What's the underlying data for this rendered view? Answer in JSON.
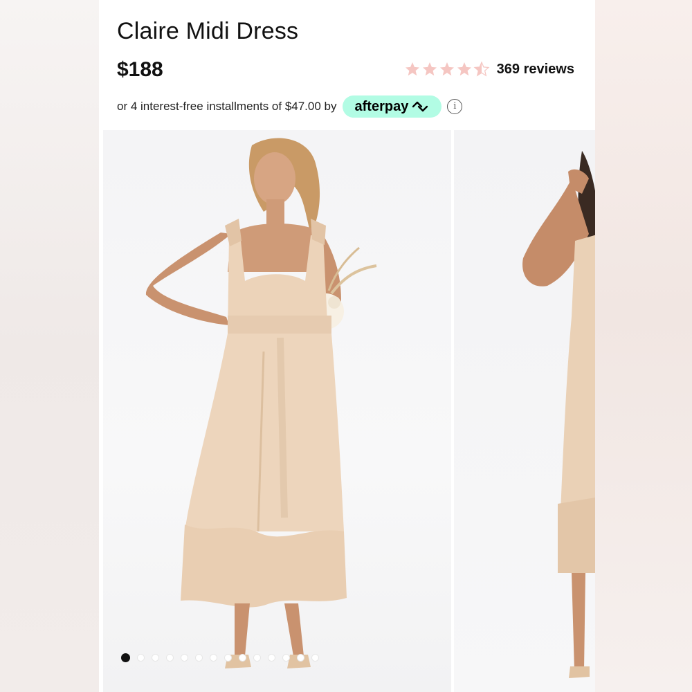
{
  "product": {
    "title": "Claire Midi Dress",
    "price": "$188",
    "rating": {
      "value": 4.5,
      "max": 5,
      "reviews_label": "369 reviews",
      "star_color": "#f5c6c2"
    },
    "afterpay": {
      "text": "or 4 interest-free installments of $47.00 by",
      "brand": "afterpay",
      "badge_color": "#b2fce4",
      "info_icon": "info-icon"
    }
  },
  "gallery": {
    "slides": [
      "product-photo-front",
      "product-photo-side"
    ],
    "dot_count": 14,
    "active_index": 0
  }
}
